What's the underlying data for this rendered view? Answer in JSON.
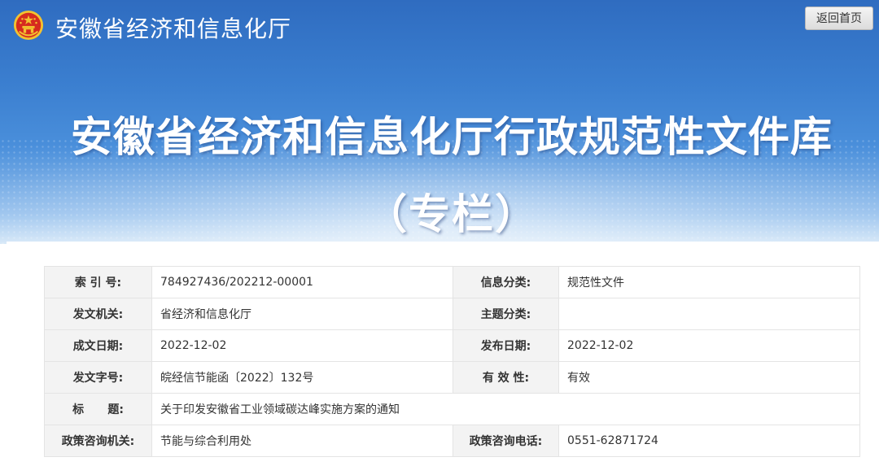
{
  "header": {
    "site_title": "安徽省经济和信息化厅",
    "back_label": "返回首页",
    "banner_title": "安徽省经济和信息化厅行政规范性文件库",
    "banner_subtitle": "（专栏）",
    "emblem_icon": "national-emblem-icon"
  },
  "colors": {
    "header_blue": "#3b7fd0",
    "label_bg": "#f3f3f3",
    "emblem_red": "#d62b1f",
    "emblem_gold": "#f2c230"
  },
  "info": {
    "index_label": "索 引 号:",
    "index_value": "784927436/202212-00001",
    "category_label": "信息分类:",
    "category_value": "规范性文件",
    "issuer_label": "发文机关:",
    "issuer_value": "省经济和信息化厅",
    "theme_label": "主题分类:",
    "theme_value": "",
    "created_label": "成文日期:",
    "created_value": "2022-12-02",
    "published_label": "发布日期:",
    "published_value": "2022-12-02",
    "docno_label": "发文字号:",
    "docno_value": "皖经信节能函〔2022〕132号",
    "validity_label": "有 效 性:",
    "validity_value": "有效",
    "title_label": "标      题:",
    "title_value": "关于印发安徽省工业领域碳达峰实施方案的通知",
    "consult_org_label": "政策咨询机关:",
    "consult_org_value": "节能与综合利用处",
    "consult_phone_label": "政策咨询电话:",
    "consult_phone_value": "0551-62871724"
  }
}
